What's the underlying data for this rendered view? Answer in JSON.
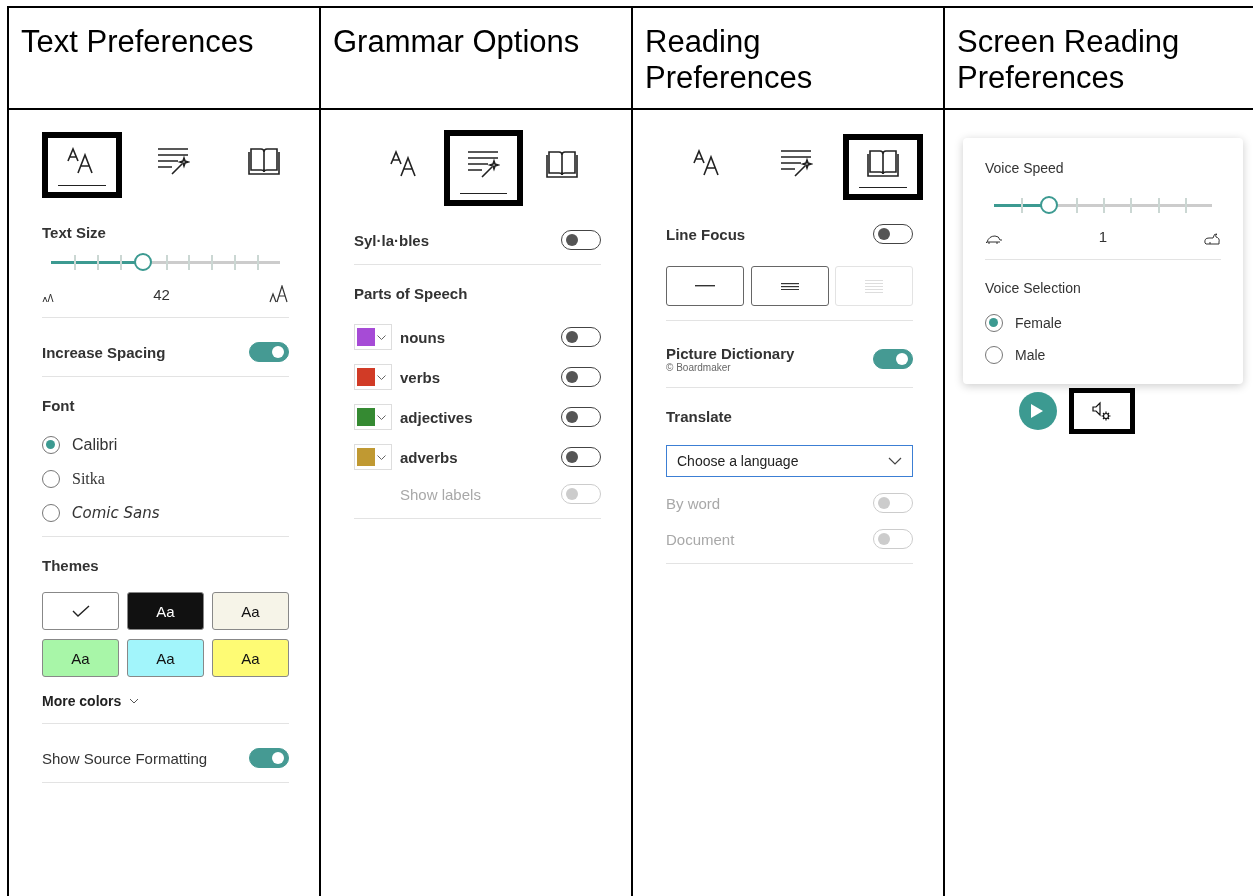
{
  "headings": [
    "Text Preferences",
    "Grammar Options",
    "Reading Preferences",
    "Screen Reading Preferences"
  ],
  "text_panel": {
    "tabs": [
      {
        "kind": "text",
        "selected": true
      },
      {
        "kind": "grammar",
        "selected": false
      },
      {
        "kind": "book",
        "selected": false
      }
    ],
    "text_size": {
      "label": "Text Size",
      "level": 0.4,
      "value": "42"
    },
    "increase_spacing": {
      "label": "Increase Spacing",
      "on": true
    },
    "font": {
      "label": "Font",
      "options": [
        {
          "label": "Calibri",
          "selected": true
        },
        {
          "label": "Sitka",
          "selected": false
        },
        {
          "label": "Comic Sans",
          "selected": false
        }
      ]
    },
    "themes": {
      "label": "Themes",
      "swatches": [
        {
          "color": "#ffffff",
          "selected": true
        },
        {
          "label": "Aa",
          "color": "#111111",
          "selected": false
        },
        {
          "label": "Aa",
          "color": "#f6f4e8",
          "selected": false
        },
        {
          "label": "Aa",
          "color": "#a8f6a8",
          "selected": false
        },
        {
          "label": "Aa",
          "color": "#a2f5fb",
          "selected": false
        },
        {
          "label": "Aa",
          "color": "#fefb74",
          "selected": false
        }
      ]
    },
    "more_colors": "More colors",
    "show_source_formatting": {
      "label": "Show Source Formatting",
      "on": true
    }
  },
  "grammar_panel": {
    "tabs": [
      {
        "kind": "text",
        "selected": false
      },
      {
        "kind": "grammar",
        "selected": true
      },
      {
        "kind": "book",
        "selected": false
      }
    ],
    "syllables": {
      "label": "Syl·la·bles",
      "on": false
    },
    "parts_heading": "Parts of Speech",
    "parts": [
      {
        "label": "nouns",
        "color": "#a64bd6",
        "on": false
      },
      {
        "label": "verbs",
        "color": "#d13b26",
        "on": false
      },
      {
        "label": "adjectives",
        "color": "#358a32",
        "on": false
      },
      {
        "label": "adverbs",
        "color": "#c09932",
        "on": false
      }
    ],
    "show_labels": {
      "label": "Show labels",
      "on": false,
      "disabled": true
    }
  },
  "reading_panel": {
    "tabs": [
      {
        "kind": "text",
        "selected": false
      },
      {
        "kind": "grammar",
        "selected": false
      },
      {
        "kind": "book",
        "selected": true
      }
    ],
    "line_focus": {
      "label": "Line Focus",
      "on": false
    },
    "focus_options": [
      {
        "kind": "one",
        "disabled": false
      },
      {
        "kind": "three",
        "disabled": false
      },
      {
        "kind": "five",
        "disabled": true
      }
    ],
    "picture_dictionary": {
      "label": "Picture Dictionary",
      "note": "© Boardmaker",
      "on": true
    },
    "translate": {
      "label": "Translate",
      "language": "Choose a language",
      "options": [
        {
          "label": "By word",
          "on": false,
          "disabled": true
        },
        {
          "label": "Document",
          "on": false,
          "disabled": true
        }
      ]
    }
  },
  "screen_panel": {
    "voice_speed": {
      "label": "Voice Speed",
      "level": 0.25,
      "value": "1"
    },
    "voice_selection": {
      "label": "Voice Selection",
      "options": [
        {
          "label": "Female",
          "selected": true
        },
        {
          "label": "Male",
          "selected": false
        }
      ]
    },
    "voice_settings": {
      "highlighted": true
    }
  }
}
